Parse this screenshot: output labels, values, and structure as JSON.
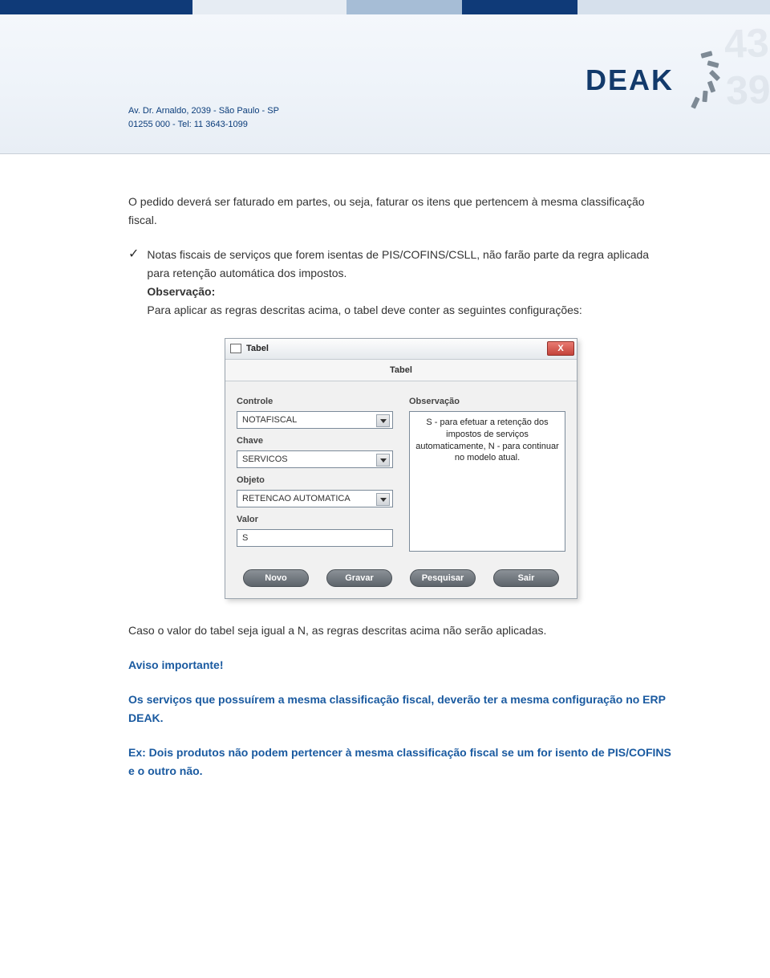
{
  "header": {
    "address_line1": "Av. Dr. Arnaldo, 2039 - São Paulo - SP",
    "address_line2": "01255 000 - Tel: 11 3643-1099",
    "logo_text": "DEAK"
  },
  "body": {
    "p1": "O pedido deverá ser faturado em partes, ou seja, faturar os itens que pertencem à mesma classificação fiscal.",
    "b1_p1": "Notas fiscais de serviços que forem isentas de PIS/COFINS/CSLL, não farão parte da regra aplicada para retenção automática dos impostos.",
    "b1_obs_label": "Observação:",
    "b1_obs_text": "Para aplicar as regras descritas acima, o tabel deve conter as seguintes configurações:",
    "p2": "Caso o valor do tabel seja igual a N, as regras descritas acima não serão aplicadas.",
    "warn_title": "Aviso importante!",
    "warn_p1": "Os serviços que possuírem a mesma classificação fiscal, deverão ter a mesma configuração no ERP DEAK.",
    "warn_p2": "Ex: Dois produtos não podem pertencer à mesma classificação fiscal se um for isento de PIS/COFINS e o outro não."
  },
  "dialog": {
    "window_title": "Tabel",
    "tab_title": "Tabel",
    "labels": {
      "controle": "Controle",
      "chave": "Chave",
      "objeto": "Objeto",
      "valor": "Valor",
      "observacao": "Observação"
    },
    "fields": {
      "controle": "NOTAFISCAL",
      "chave": "SERVICOS",
      "objeto": "RETENCAO AUTOMATICA",
      "valor": "S"
    },
    "observacao_text": "S - para efetuar a retenção dos impostos de serviços automaticamente, N - para continuar no modelo atual.",
    "buttons": {
      "novo": "Novo",
      "gravar": "Gravar",
      "pesquisar": "Pesquisar",
      "sair": "Sair"
    }
  }
}
